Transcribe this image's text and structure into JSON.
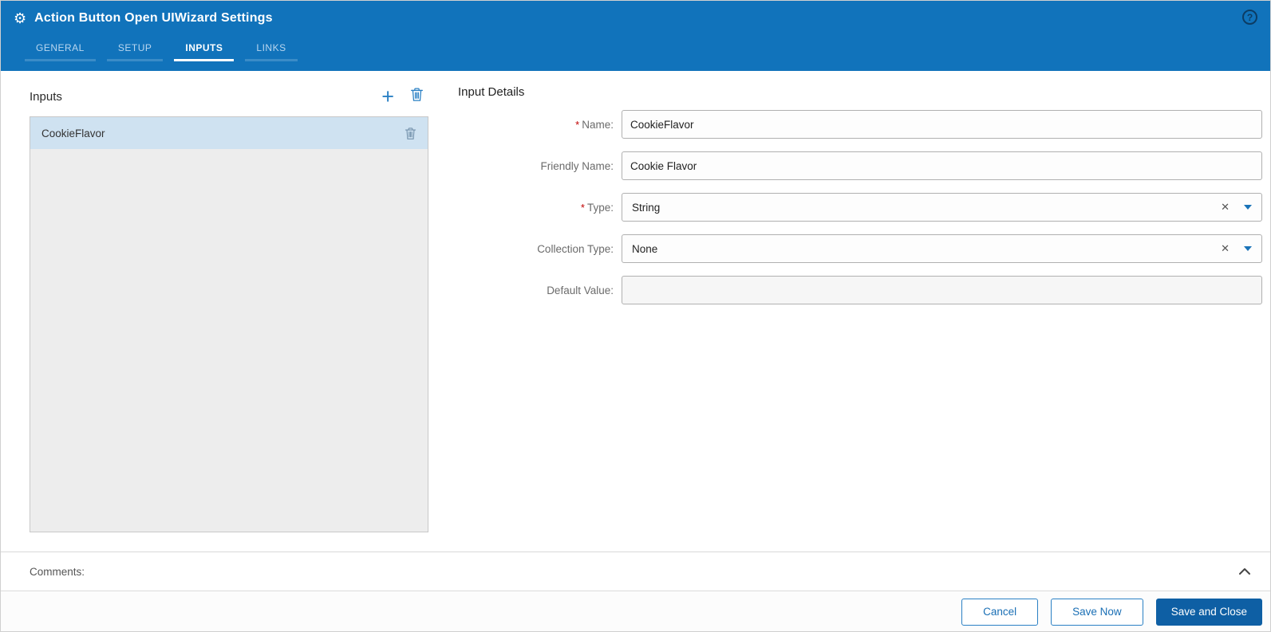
{
  "header": {
    "title": "Action Button Open UIWizard Settings",
    "tabs": [
      {
        "label": "GENERAL"
      },
      {
        "label": "SETUP"
      },
      {
        "label": "INPUTS"
      },
      {
        "label": "LINKS"
      }
    ]
  },
  "inputs_panel": {
    "title": "Inputs",
    "items": [
      {
        "name": "CookieFlavor",
        "selected": true
      }
    ]
  },
  "details": {
    "title": "Input Details",
    "fields": [
      {
        "label": "Name:",
        "star": "*",
        "value": "CookieFlavor"
      },
      {
        "label": "Friendly Name:",
        "star": "",
        "value": "Cookie Flavor"
      },
      {
        "label": "Type:",
        "star": "*",
        "value": "String"
      },
      {
        "label": "Collection Type:",
        "star": "",
        "value": "None"
      },
      {
        "label": "Default Value:",
        "star": "",
        "value": ""
      }
    ]
  },
  "comments": {
    "label": "Comments:"
  },
  "footer": {
    "cancel_label": "Cancel",
    "save_now_label": "Save Now",
    "save_close_label": "Save and Close"
  },
  "icons": {
    "gear": "⚙",
    "help": "?",
    "add": "+",
    "clear": "✕"
  },
  "colors": {
    "header_bg": "#1173bb",
    "accent_blue": "#2a80c4",
    "selected_item_bg": "#cfe2f1",
    "primary_button_bg": "#0e5fa4",
    "required_red": "#c00000"
  }
}
